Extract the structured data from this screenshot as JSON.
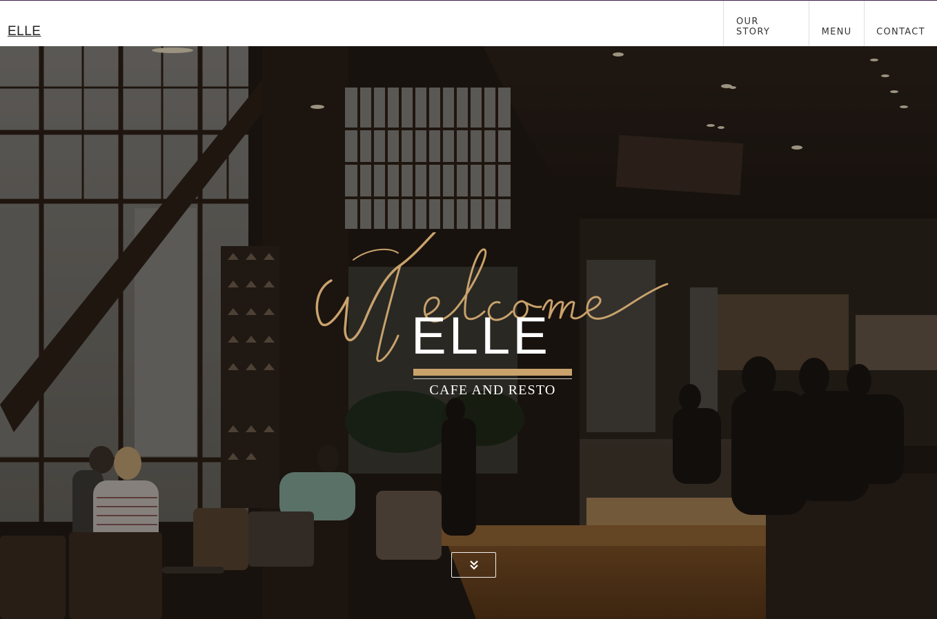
{
  "navbar": {
    "brand": "ELLE",
    "links": [
      "OUR STORY",
      "MENU",
      "CONTACT"
    ]
  },
  "hero": {
    "script_word": "Welcome",
    "title": "ELLE",
    "tagline": "CAFE AND RESTO",
    "scroll_icon": "double-chevron-down-icon"
  },
  "colors": {
    "gold": "#c9a26c",
    "nav_bg": "#ffffff",
    "overlay": "#1b1512"
  }
}
